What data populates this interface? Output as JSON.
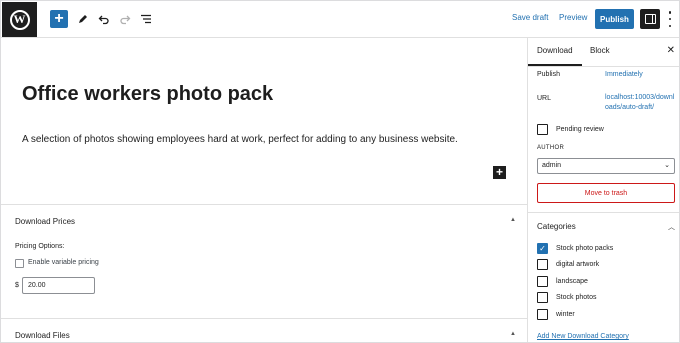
{
  "toolbar": {
    "logo_letter": "W",
    "save_draft": "Save draft",
    "preview": "Preview",
    "publish": "Publish",
    "accent_color": "#2271b1"
  },
  "post": {
    "title": "Office workers photo pack",
    "body": "A selection of photos showing employees hard at work, perfect for adding to any business website."
  },
  "metaboxes": {
    "prices": {
      "title": "Download Prices",
      "pricing_options_label": "Pricing Options:",
      "variable_pricing_label": "Enable variable pricing",
      "variable_pricing_checked": false,
      "currency_symbol": "$",
      "price_value": "20.00"
    },
    "files": {
      "title": "Download Files"
    }
  },
  "sidebar": {
    "tabs": [
      "Download",
      "Block"
    ],
    "active_tab": "Download",
    "publish_label": "Publish",
    "publish_value": "Immediately",
    "url_label": "URL",
    "url_value": "localhost:10003/downloads/auto-draft/",
    "pending_review_label": "Pending review",
    "pending_review_checked": false,
    "author_label": "AUTHOR",
    "author_value": "admin",
    "trash_label": "Move to trash",
    "categories_title": "Categories",
    "categories": [
      {
        "label": "Stock photo packs",
        "checked": true
      },
      {
        "label": "digital artwork",
        "checked": false
      },
      {
        "label": "landscape",
        "checked": false
      },
      {
        "label": "Stock photos",
        "checked": false
      },
      {
        "label": "winter",
        "checked": false
      }
    ],
    "add_category_link": "Add New Download Category"
  }
}
